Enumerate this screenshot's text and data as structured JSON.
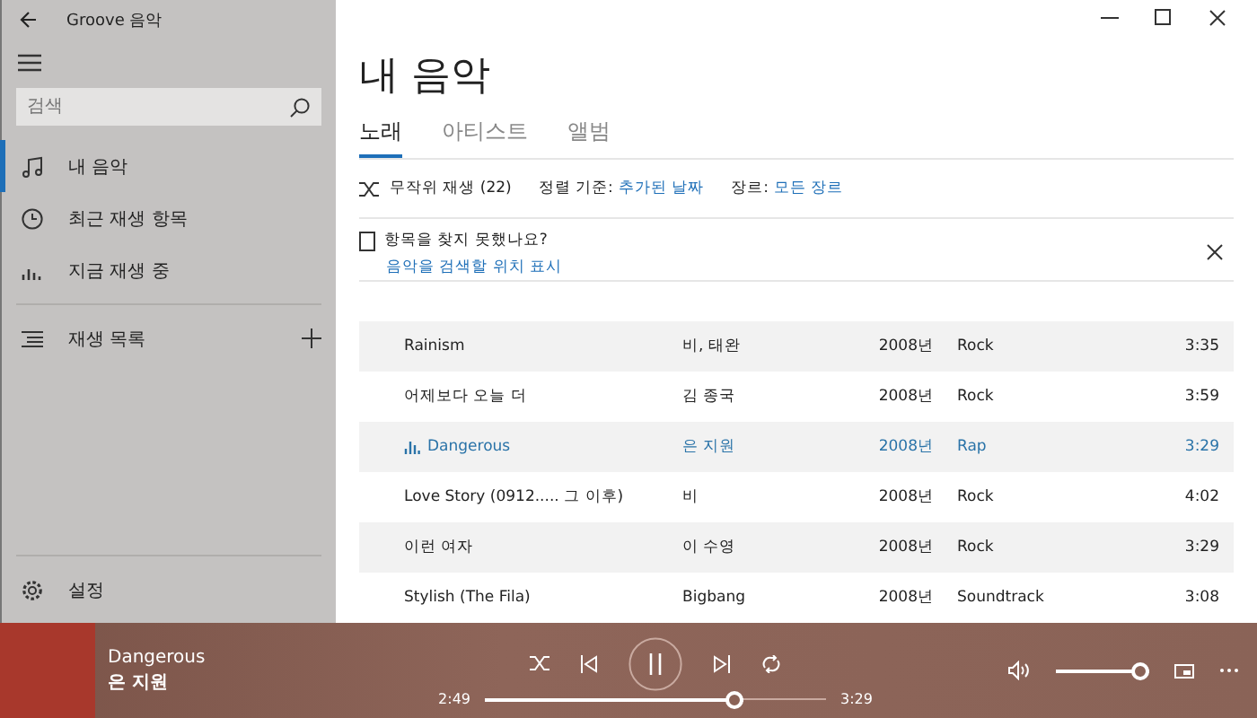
{
  "app": {
    "title": "Groove 음악"
  },
  "sidebar": {
    "search": {
      "placeholder": "검색"
    },
    "items": [
      {
        "label": "내 음악",
        "kind": "note",
        "selected": true
      },
      {
        "label": "최근 재생 항목",
        "kind": "clock",
        "selected": false
      },
      {
        "label": "지금 재생 중",
        "kind": "bars",
        "selected": false
      }
    ],
    "playlists": {
      "label": "재생 목록"
    },
    "settings": {
      "label": "설정"
    }
  },
  "page": {
    "title": "내 음악",
    "tabs": [
      {
        "label": "노래",
        "selected": true
      },
      {
        "label": "아티스트",
        "selected": false
      },
      {
        "label": "앨범",
        "selected": false
      }
    ],
    "toolbar": {
      "shuffle": "무작위 재생 (22)",
      "sort_label": "정렬 기준:",
      "sort_value": "추가된 날짜",
      "genre_label": "장르:",
      "genre_value": "모든 장르"
    },
    "notice": {
      "title": "항목을 찾지 못했나요?",
      "link": "음악을 검색할 위치 표시"
    }
  },
  "songs": [
    {
      "title": "Rainism",
      "artist": "비, 태완",
      "year": "2008년",
      "genre": "Rock",
      "duration": "3:35",
      "playing": false
    },
    {
      "title": "어제보다 오늘 더",
      "artist": "김 종국",
      "year": "2008년",
      "genre": "Rock",
      "duration": "3:59",
      "playing": false
    },
    {
      "title": "Dangerous",
      "artist": "은 지원",
      "year": "2008년",
      "genre": "Rap",
      "duration": "3:29",
      "playing": true
    },
    {
      "title": "Love Story (0912..... 그 이후)",
      "artist": "비",
      "year": "2008년",
      "genre": "Rock",
      "duration": "4:02",
      "playing": false
    },
    {
      "title": "이런 여자",
      "artist": "이 수영",
      "year": "2008년",
      "genre": "Rock",
      "duration": "3:29",
      "playing": false
    },
    {
      "title": "Stylish (The Fila)",
      "artist": "Bigbang",
      "year": "2008년",
      "genre": "Soundtrack",
      "duration": "3:08",
      "playing": false
    }
  ],
  "player": {
    "title": "Dangerous",
    "artist": "은 지원",
    "elapsed": "2:49",
    "total": "3:29",
    "progress": {
      "level": 0.76
    },
    "volume": {
      "level": 1
    }
  }
}
